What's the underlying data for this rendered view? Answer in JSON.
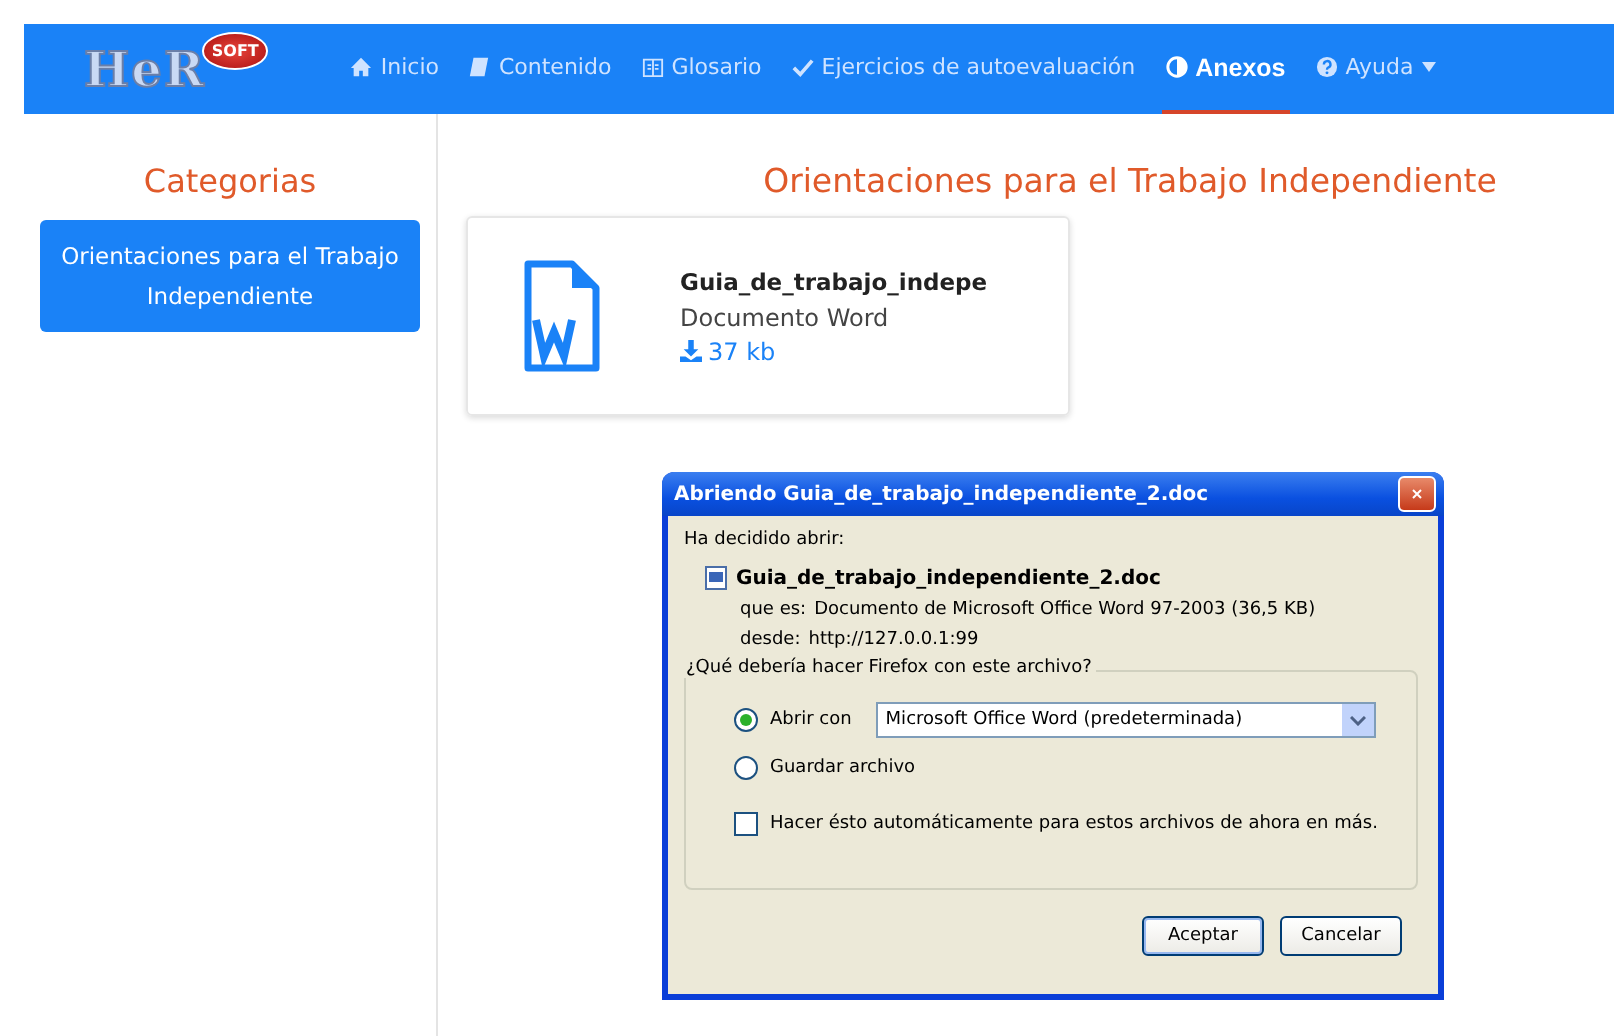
{
  "navbar": {
    "logo": {
      "text": "HeR",
      "badge": "SOFT"
    },
    "items": [
      {
        "label": "Inicio",
        "selected": false,
        "dropdown": false
      },
      {
        "label": "Contenido",
        "selected": false,
        "dropdown": false
      },
      {
        "label": "Glosario",
        "selected": false,
        "dropdown": false
      },
      {
        "label": "Ejercicios de autoevaluación",
        "selected": false,
        "dropdown": false
      },
      {
        "label": "Anexos",
        "selected": true,
        "dropdown": false
      },
      {
        "label": "Ayuda",
        "selected": false,
        "dropdown": true
      }
    ]
  },
  "sidebar": {
    "title": "Categorias",
    "items": [
      {
        "label": "Orientaciones para el Trabajo Independiente",
        "selected": true
      }
    ]
  },
  "main": {
    "title": "Orientaciones para el Trabajo Independiente",
    "files": [
      {
        "name": "Guia_de_trabajo_indepe",
        "type": "Documento Word",
        "size": "37 kb"
      }
    ]
  },
  "dialog": {
    "title": "Abriendo Guia_de_trabajo_independiente_2.doc",
    "intro": "Ha decidido abrir:",
    "file_name": "Guia_de_trabajo_independiente_2.doc",
    "details": [
      {
        "label": "que es:",
        "value": "Documento de Microsoft Office Word 97-2003 (36,5 KB)"
      },
      {
        "label": "desde:",
        "value": "http://127.0.0.1:99"
      }
    ],
    "group_title": "¿Qué debería hacer Firefox con este archivo?",
    "options": [
      {
        "label": "Abrir con",
        "selected": true,
        "select_value": "Microsoft Office Word (predeterminada)"
      },
      {
        "label": "Guardar archivo",
        "selected": false
      }
    ],
    "remember": {
      "label": "Hacer ésto automáticamente para estos archivos de ahora en más.",
      "checked": false
    },
    "buttons": [
      {
        "label": "Aceptar",
        "default": true
      },
      {
        "label": "Cancelar",
        "default": false
      }
    ]
  }
}
